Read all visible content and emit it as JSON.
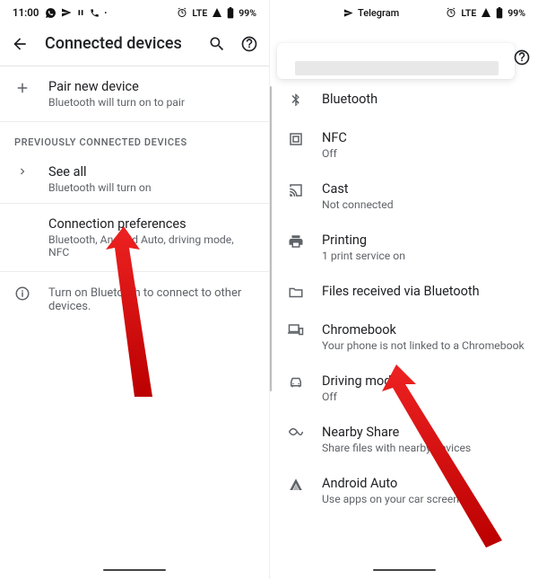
{
  "left": {
    "status": {
      "time": "11:00",
      "net": "LTE",
      "battery": "99%"
    },
    "header": {
      "title": "Connected devices"
    },
    "pair": {
      "title": "Pair new device",
      "sub": "Bluetooth will turn on to pair"
    },
    "section_label": "PREVIOUSLY CONNECTED DEVICES",
    "see_all": {
      "title": "See all",
      "sub": "Bluetooth will turn on"
    },
    "conn_pref": {
      "title": "Connection preferences",
      "sub": "Bluetooth, Android Auto, driving mode, NFC"
    },
    "tip": "Turn on Bluetooth to connect to other devices."
  },
  "right": {
    "status": {
      "app": "Telegram",
      "net": "LTE",
      "battery": "99%"
    },
    "items": [
      {
        "icon": "bluetooth",
        "title": "Bluetooth",
        "sub": ""
      },
      {
        "icon": "nfc",
        "title": "NFC",
        "sub": "Off"
      },
      {
        "icon": "cast",
        "title": "Cast",
        "sub": "Not connected"
      },
      {
        "icon": "print",
        "title": "Printing",
        "sub": "1 print service on"
      },
      {
        "icon": "folder",
        "title": "Files received via Bluetooth",
        "sub": ""
      },
      {
        "icon": "chromebook",
        "title": "Chromebook",
        "sub": "Your phone is not linked to a Chromebook"
      },
      {
        "icon": "car",
        "title": "Driving mode",
        "sub": "Off"
      },
      {
        "icon": "share",
        "title": "Nearby Share",
        "sub": "Share files with nearby devices"
      },
      {
        "icon": "aa",
        "title": "Android Auto",
        "sub": "Use apps on your car screen"
      }
    ]
  }
}
